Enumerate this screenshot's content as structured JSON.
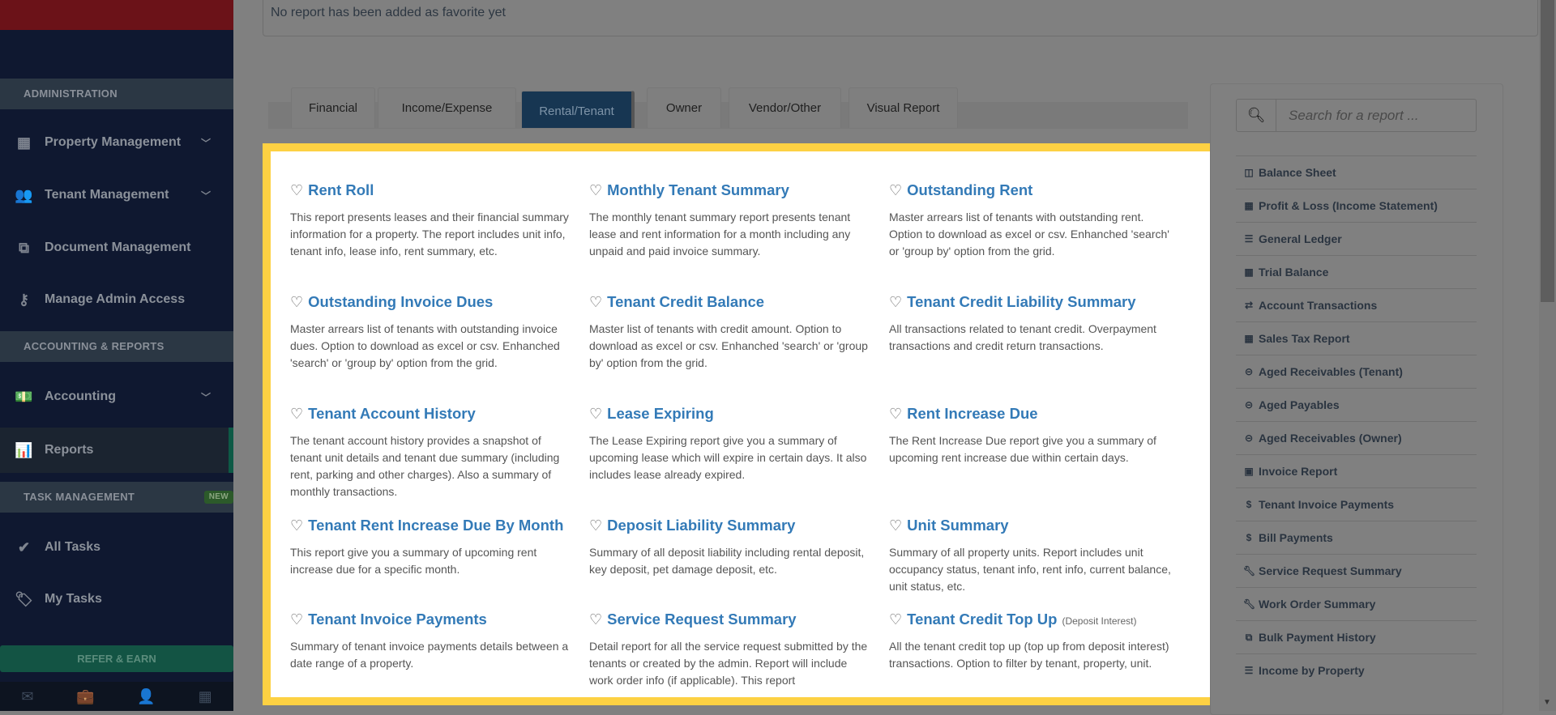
{
  "sidebar": {
    "sections": {
      "admin": "ADMINISTRATION",
      "accounting": "ACCOUNTING & REPORTS",
      "tasks": "TASK MANAGEMENT"
    },
    "new_badge": "NEW",
    "items": [
      {
        "label": "Property Management",
        "icon": "building-icon"
      },
      {
        "label": "Tenant Management",
        "icon": "users-icon"
      },
      {
        "label": "Document Management",
        "icon": "documents-icon"
      },
      {
        "label": "Manage Admin Access",
        "icon": "key-icon"
      },
      {
        "label": "Accounting",
        "icon": "money-icon"
      },
      {
        "label": "Reports",
        "icon": "bar-chart-icon"
      },
      {
        "label": "All Tasks",
        "icon": "check-icon"
      },
      {
        "label": "My Tasks",
        "icon": "tag-icon"
      }
    ],
    "refer": "REFER & EARN"
  },
  "favorites": {
    "empty_text": "No report has been added as favorite yet"
  },
  "tabs": [
    "Financial",
    "Income/Expense",
    "Rental/Tenant",
    "Owner",
    "Vendor/Other",
    "Visual Report"
  ],
  "active_tab": "Rental/Tenant",
  "reports": [
    {
      "title": "Rent Roll",
      "desc": "This report presents leases and their financial summary information for a property. The report includes unit info, tenant info, lease info, rent summary, etc."
    },
    {
      "title": "Monthly Tenant Summary",
      "desc": "The monthly tenant summary report presents tenant lease and rent information for a month including any unpaid and paid invoice summary."
    },
    {
      "title": "Outstanding Rent",
      "desc": "Master arrears list of tenants with outstanding rent. Option to download as excel or csv. Enhanched 'search' or 'group by' option from the grid."
    },
    {
      "title": "Outstanding Invoice Dues",
      "desc": "Master arrears list of tenants with outstanding invoice dues. Option to download as excel or csv. Enhanched 'search' or 'group by' option from the grid."
    },
    {
      "title": "Tenant Credit Balance",
      "desc": "Master list of tenants with credit amount. Option to download as excel or csv. Enhanched 'search' or 'group by' option from the grid."
    },
    {
      "title": "Tenant Credit Liability Summary",
      "desc": "All transactions related to tenant credit. Overpayment transactions and credit return transactions."
    },
    {
      "title": "Tenant Account History",
      "desc": "The tenant account history provides a snapshot of tenant unit details and tenant due summary (including rent, parking and other charges). Also a summary of monthly transactions."
    },
    {
      "title": "Lease Expiring",
      "desc": "The Lease Expiring report give you a summary of upcoming lease which will expire in certain days. It also includes lease already expired."
    },
    {
      "title": "Rent Increase Due",
      "desc": "The Rent Increase Due report give you a summary of upcoming rent increase due within certain days."
    },
    {
      "title": "Tenant Rent Increase Due By Month",
      "desc": "This report give you a summary of upcoming rent increase due for a specific month."
    },
    {
      "title": "Deposit Liability Summary",
      "desc": "Summary of all deposit liability including rental deposit, key deposit, pet damage deposit, etc."
    },
    {
      "title": "Unit Summary",
      "desc": "Summary of all property units. Report includes unit occupancy status, tenant info, rent info, current balance, unit status, etc."
    },
    {
      "title": "Tenant Invoice Payments",
      "desc": "Summary of tenant invoice payments details between a date range of a property."
    },
    {
      "title": "Service Request Summary",
      "desc": "Detail report for all the service request submitted by the tenants or created by the admin. Report will include work order info (if applicable). This report"
    },
    {
      "title": "Tenant Credit Top Up",
      "note": "(Deposit Interest)",
      "desc": "All the tenant credit top up (top up from deposit interest) transactions. Option to filter by tenant, property, unit."
    }
  ],
  "search": {
    "placeholder": "Search for a report ..."
  },
  "quick_reports": [
    {
      "label": "Balance Sheet",
      "icon": "columns-icon"
    },
    {
      "label": "Profit & Loss (Income Statement)",
      "icon": "calculator-icon"
    },
    {
      "label": "General Ledger",
      "icon": "list-icon"
    },
    {
      "label": "Trial Balance",
      "icon": "calendar-icon"
    },
    {
      "label": "Account Transactions",
      "icon": "exchange-icon"
    },
    {
      "label": "Sales Tax Report",
      "icon": "calculator-icon"
    },
    {
      "label": "Aged Receivables (Tenant)",
      "icon": "circle-arrow-icon"
    },
    {
      "label": "Aged Payables",
      "icon": "circle-arrow-icon"
    },
    {
      "label": "Aged Receivables (Owner)",
      "icon": "circle-arrow-icon"
    },
    {
      "label": "Invoice Report",
      "icon": "file-code-icon"
    },
    {
      "label": "Tenant Invoice Payments",
      "icon": "dollar-icon"
    },
    {
      "label": "Bill Payments",
      "icon": "dollar-icon"
    },
    {
      "label": "Service Request Summary",
      "icon": "wrench-icon"
    },
    {
      "label": "Work Order Summary",
      "icon": "wrench-icon"
    },
    {
      "label": "Bulk Payment History",
      "icon": "documents-icon"
    },
    {
      "label": "Income by Property",
      "icon": "indent-list-icon"
    }
  ],
  "colors": {
    "highlight": "#fdd143",
    "link": "#337ab7",
    "active_tab": "#173652"
  }
}
